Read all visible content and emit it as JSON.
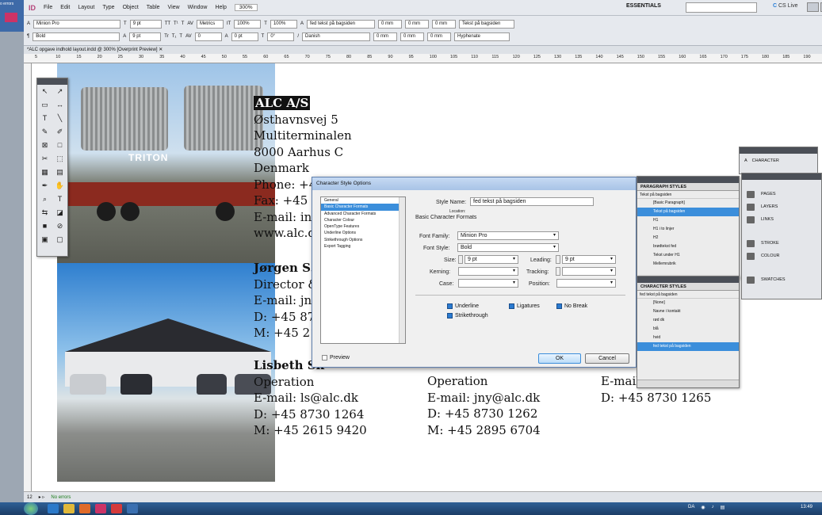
{
  "left_strip": {
    "errors_label": "o errors"
  },
  "menubar": {
    "logo": "ID",
    "items": [
      "File",
      "Edit",
      "Layout",
      "Type",
      "Object",
      "Table",
      "View",
      "Window",
      "Help"
    ],
    "zoom": "300%",
    "workspace": "ESSENTIALS",
    "search_placeholder": "",
    "cs_live": "CS Live"
  },
  "control_bar": {
    "font_family": "Minion Pro",
    "font_style": "Bold",
    "font_size": "9 pt",
    "leading": "9 pt",
    "kerning": "Metrics",
    "tracking": "0",
    "scale_h": "100%",
    "scale_v": "100%",
    "baseline": "0 pt",
    "skew": "0°",
    "char_style": "fed tekst på bagsiden",
    "language": "Danish",
    "indent_1": "0 mm",
    "indent_2": "0 mm",
    "indent_3": "0 mm",
    "indent_4": "0 mm",
    "indent_5": "0 mm",
    "indent_6": "0 mm",
    "para_style": "Tekst på bagsiden",
    "hyphenate": "Hyphenate"
  },
  "doc_tab": {
    "title": "*ALC opgave indhold layout.indd @ 300% [Overprint Preview]"
  },
  "ruler_marks": [
    "5",
    "10",
    "15",
    "20",
    "25",
    "30",
    "35",
    "40",
    "45",
    "50",
    "55",
    "60",
    "65",
    "70",
    "75",
    "80",
    "85",
    "90",
    "95",
    "100",
    "105",
    "110",
    "115",
    "120",
    "125",
    "130",
    "135",
    "140",
    "145",
    "150",
    "155",
    "160",
    "165",
    "170",
    "175",
    "180",
    "185",
    "190"
  ],
  "photo1": {
    "truck_text": "TRITON"
  },
  "document": {
    "company": "ALC A/S",
    "address_lines": [
      "Østhavnsvej 5",
      "Multiterminalen",
      "8000 Aarhus C",
      "Denmark",
      "Phone: +4",
      "Fax: +45 8",
      "E-mail: inf",
      "www.alc.d"
    ],
    "contact1": {
      "name": "Jørgen S. N",
      "lines": [
        "Director &",
        "E-mail: jn(",
        "D: +45 873",
        "M: +45 21"
      ]
    },
    "contact2": {
      "name": "Lisbeth Sk",
      "lines": [
        "Operation",
        "E-mail: ls@alc.dk",
        "D: +45 8730 1264",
        "M: +45 2615 9420"
      ]
    },
    "contact3": {
      "lines": [
        "Operation",
        "E-mail: jny@alc.dk",
        "D: +45 8730 1262",
        "M: +45 2895 6704"
      ]
    },
    "contact4": {
      "lines": [
        "E-mail:",
        "D: +45 8730 1265"
      ]
    }
  },
  "dialog": {
    "title": "Character Style Options",
    "categories": [
      "General",
      "Basic Character Formats",
      "Advanced Character Formats",
      "Character Colour",
      "OpenType Features",
      "Underline Options",
      "Strikethrough Options",
      "Export Tagging"
    ],
    "selected_category": "Basic Character Formats",
    "style_name_label": "Style Name:",
    "style_name": "fed tekst på bagsiden",
    "location_label": "Location:",
    "section": "Basic Character Formats",
    "font_family_label": "Font Family:",
    "font_family": "Minion Pro",
    "font_style_label": "Font Style:",
    "font_style": "Bold",
    "size_label": "Size:",
    "size": "9 pt",
    "leading_label": "Leading:",
    "leading": "9 pt",
    "kerning_label": "Kerning:",
    "kerning": "",
    "tracking_label": "Tracking:",
    "tracking": "",
    "case_label": "Case:",
    "case": "",
    "position_label": "Position:",
    "position": "",
    "underline": "Underline",
    "ligatures": "Ligatures",
    "no_break": "No Break",
    "strikethrough": "Strikethrough",
    "preview": "Preview",
    "ok": "OK",
    "cancel": "Cancel"
  },
  "paragraph_styles": {
    "tab": "PARAGRAPH STYLES",
    "current": "Tekst på bagsiden",
    "items": [
      "[Basic Paragraph]",
      "Tekst på bagsiden",
      "H1",
      "H1 i to linjer",
      "H2",
      "brødtekst fed",
      "Tekst under H1",
      "Mellemrubrik"
    ],
    "selected": "Tekst på bagsiden"
  },
  "character_styles": {
    "tab": "CHARACTER STYLES",
    "current": "fed tekst på bagsiden",
    "items": [
      "[None]",
      "Navne i kontakt",
      "rød dk",
      "blå",
      "hvid",
      "fed tekst på bagsiden"
    ],
    "selected": "fed tekst på bagsiden"
  },
  "character_panel": {
    "label": "CHARACTER"
  },
  "dock": {
    "items": [
      "PAGES",
      "LAYERS",
      "LINKS",
      "STROKE",
      "COLOUR",
      "SWATCHES"
    ]
  },
  "statusbar": {
    "page": "12",
    "errors": "No errors"
  },
  "taskbar": {
    "lang": "DA",
    "time": "13:49"
  }
}
